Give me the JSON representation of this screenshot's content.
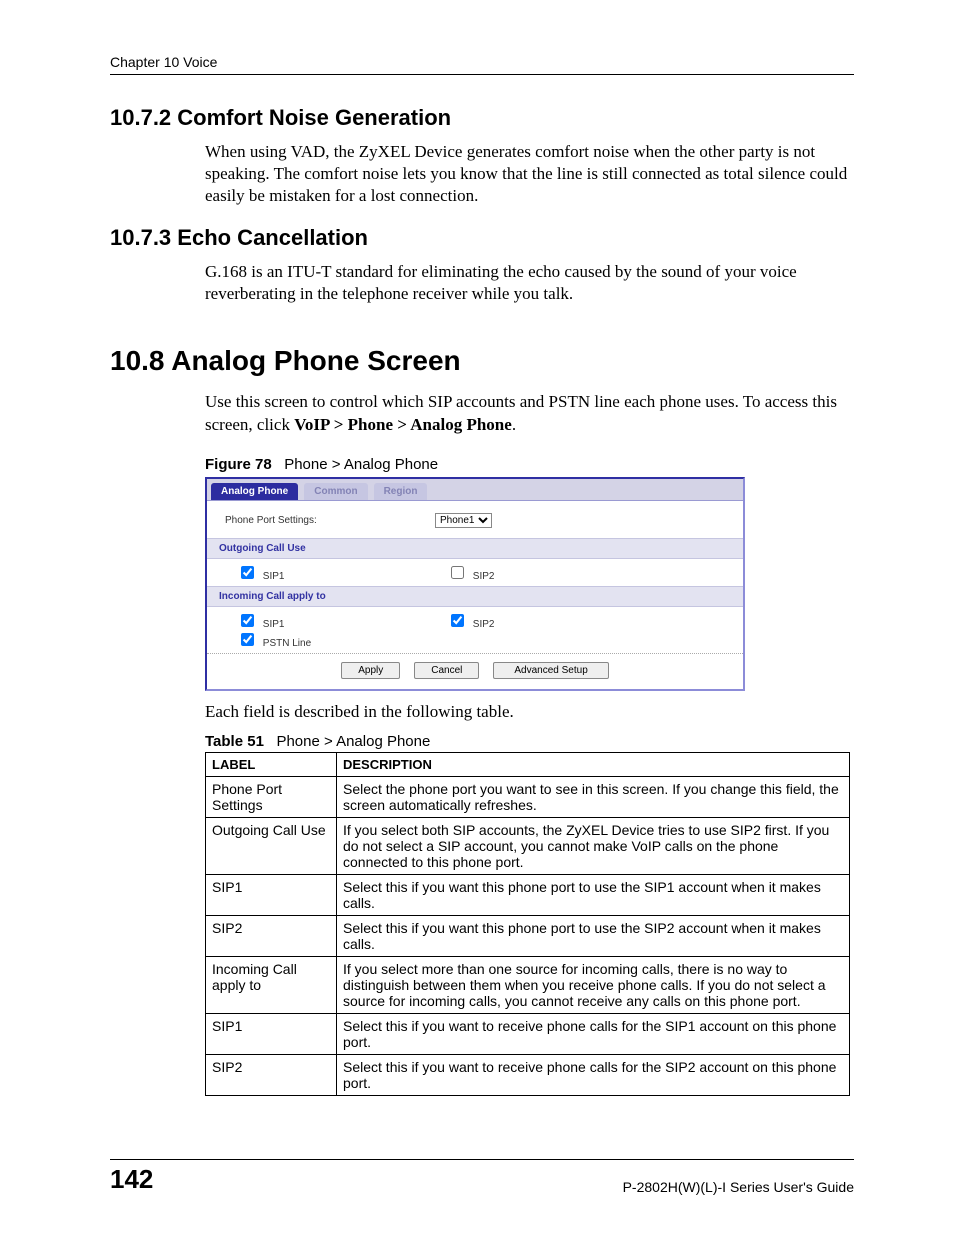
{
  "header": "Chapter 10 Voice",
  "s1": {
    "heading": "10.7.2  Comfort Noise Generation",
    "body": "When using VAD, the ZyXEL Device generates comfort noise when the other party is not speaking. The comfort noise lets you know that the line is still connected as total silence could easily be mistaken for a lost connection."
  },
  "s2": {
    "heading": "10.7.3  Echo Cancellation",
    "body": "G.168 is an ITU-T standard for eliminating the echo caused by the sound of your voice reverberating in the telephone receiver while you talk."
  },
  "s3": {
    "heading": "10.8  Analog Phone Screen",
    "body_pre": "Use this screen to control which SIP accounts and PSTN line each phone uses. To access this screen, click ",
    "body_bold": "VoIP > Phone > Analog Phone",
    "body_post": "."
  },
  "figure": {
    "label": "Figure 78",
    "caption": "Phone > Analog Phone"
  },
  "ui": {
    "tabs": {
      "active": "Analog Phone",
      "t2": "Common",
      "t3": "Region"
    },
    "port_label": "Phone Port Settings:",
    "port_select_value": "Phone1",
    "group_outgoing": "Outgoing Call Use",
    "group_incoming": "Incoming Call apply to",
    "sip1": "SIP1",
    "sip2": "SIP2",
    "pstn": "PSTN Line",
    "btn_apply": "Apply",
    "btn_cancel": "Cancel",
    "btn_adv": "Advanced Setup"
  },
  "after_figure": "Each field is described in the following table.",
  "table": {
    "label": "Table 51",
    "caption": "Phone > Analog Phone",
    "head_label": "LABEL",
    "head_desc": "DESCRIPTION",
    "rows": [
      {
        "label": "Phone Port Settings",
        "desc": "Select the phone port you want to see in this screen. If you change this field, the screen automatically refreshes."
      },
      {
        "label": "Outgoing Call Use",
        "desc": "If you select both SIP accounts, the ZyXEL Device tries to use SIP2 first. If you do not select a SIP account, you cannot make VoIP calls on the phone connected to this phone port."
      },
      {
        "label": "SIP1",
        "desc": "Select this if you want this phone port to use the SIP1 account when it makes calls."
      },
      {
        "label": "SIP2",
        "desc": "Select this if you want this phone port to use the SIP2 account when it makes calls."
      },
      {
        "label": "Incoming Call apply to",
        "desc": "If you select more than one source for incoming calls, there is no way to distinguish between them when you receive phone calls. If you do not select a source for incoming calls, you cannot receive any calls on this phone port."
      },
      {
        "label": "SIP1",
        "desc": "Select this if you want to receive phone calls for the SIP1 account on this phone port."
      },
      {
        "label": "SIP2",
        "desc": "Select this if you want to receive phone calls for the SIP2 account on this phone port."
      }
    ]
  },
  "footer": {
    "page": "142",
    "guide": "P-2802H(W)(L)-I Series User's Guide"
  }
}
